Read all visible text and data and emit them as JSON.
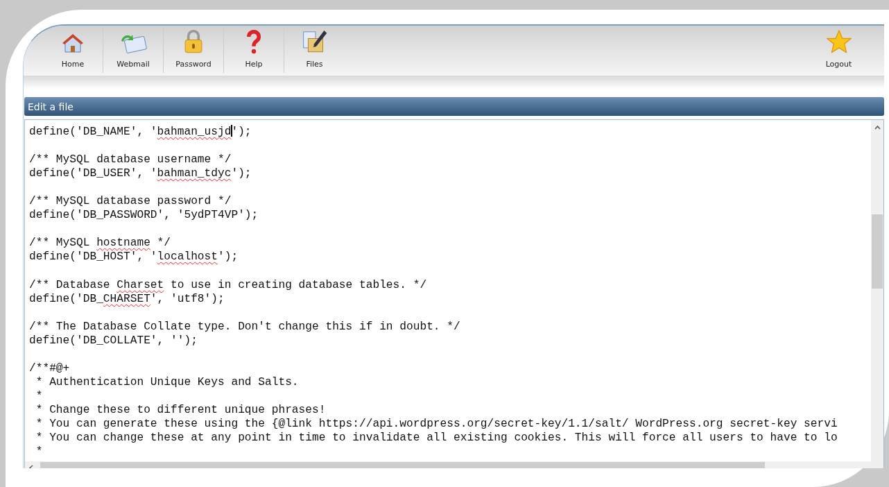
{
  "toolbar": {
    "items": [
      {
        "label": "Home"
      },
      {
        "label": "Webmail"
      },
      {
        "label": "Password"
      },
      {
        "label": "Help"
      },
      {
        "label": "Files"
      }
    ],
    "logout": {
      "label": "Logout"
    }
  },
  "panel": {
    "title": "Edit a file"
  },
  "editor": {
    "lines": [
      {
        "kind": "code",
        "segments": [
          {
            "text": "define('DB_NAME', '"
          },
          {
            "text": "bahman_usjd",
            "misspelled": true,
            "caret_after": true
          },
          {
            "text": "');"
          }
        ]
      },
      {
        "kind": "blank"
      },
      {
        "kind": "code",
        "segments": [
          {
            "text": "/** MySQL database username */"
          }
        ]
      },
      {
        "kind": "code",
        "segments": [
          {
            "text": "define('DB_USER', '"
          },
          {
            "text": "bahman_tdyc",
            "misspelled": true
          },
          {
            "text": "');"
          }
        ]
      },
      {
        "kind": "blank"
      },
      {
        "kind": "code",
        "segments": [
          {
            "text": "/** MySQL database password */"
          }
        ]
      },
      {
        "kind": "code",
        "segments": [
          {
            "text": "define('DB_PASSWORD', '5ydPT4VP');"
          }
        ]
      },
      {
        "kind": "blank"
      },
      {
        "kind": "code",
        "segments": [
          {
            "text": "/** MySQL "
          },
          {
            "text": "hostname",
            "misspelled": true
          },
          {
            "text": " */"
          }
        ]
      },
      {
        "kind": "code",
        "segments": [
          {
            "text": "define('DB_HOST', '"
          },
          {
            "text": "localhost",
            "misspelled": true
          },
          {
            "text": "');"
          }
        ]
      },
      {
        "kind": "blank"
      },
      {
        "kind": "code",
        "segments": [
          {
            "text": "/** Database "
          },
          {
            "text": "Charset",
            "misspelled": true
          },
          {
            "text": " to use in creating database tables. */"
          }
        ]
      },
      {
        "kind": "code",
        "segments": [
          {
            "text": "define('DB_"
          },
          {
            "text": "CHARSET",
            "misspelled": true
          },
          {
            "text": "', 'utf8');"
          }
        ]
      },
      {
        "kind": "blank"
      },
      {
        "kind": "code",
        "segments": [
          {
            "text": "/** The Database Collate type. Don't change this if in doubt. */"
          }
        ]
      },
      {
        "kind": "code",
        "segments": [
          {
            "text": "define('DB_COLLATE', '');"
          }
        ]
      },
      {
        "kind": "blank"
      },
      {
        "kind": "code",
        "segments": [
          {
            "text": "/**#@+"
          }
        ]
      },
      {
        "kind": "code",
        "segments": [
          {
            "text": " * Authentication Unique Keys and Salts."
          }
        ]
      },
      {
        "kind": "code",
        "segments": [
          {
            "text": " *"
          }
        ]
      },
      {
        "kind": "code",
        "segments": [
          {
            "text": " * Change these to different unique phrases!"
          }
        ]
      },
      {
        "kind": "code",
        "segments": [
          {
            "text": " * You can generate these using the {@link https://api.wordpress.org/secret-key/1.1/salt/ WordPress.org secret-key servi"
          }
        ]
      },
      {
        "kind": "code",
        "segments": [
          {
            "text": " * You can change these at any point in time to invalidate all existing cookies. This will force all users to have to lo"
          }
        ]
      },
      {
        "kind": "code",
        "segments": [
          {
            "text": " *"
          }
        ]
      }
    ]
  }
}
